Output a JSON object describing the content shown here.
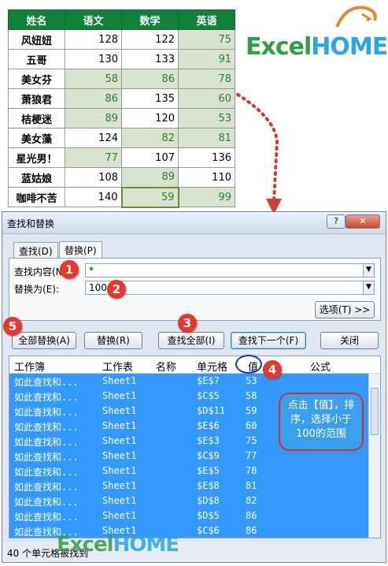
{
  "sheet": {
    "headers": [
      "姓名",
      "语文",
      "数学",
      "英语"
    ],
    "rows": [
      [
        "风妞妞",
        "128",
        "122",
        "75"
      ],
      [
        "五哥",
        "130",
        "133",
        "91"
      ],
      [
        "美女芬",
        "58",
        "86",
        "78"
      ],
      [
        "萧狼君",
        "86",
        "135",
        "60"
      ],
      [
        "桔梗迷",
        "89",
        "120",
        "53"
      ],
      [
        "美女藻",
        "124",
        "82",
        "81"
      ],
      [
        "星光男！",
        "77",
        "107",
        "136"
      ],
      [
        "蓝姑娘",
        "108",
        "89",
        "110"
      ],
      [
        "咖啡不苦",
        "140",
        "59",
        "99"
      ]
    ],
    "header_color": "#10803b",
    "highlight_color": "#d9e4d0"
  },
  "logo": {
    "part1": "Excel",
    "part2": "HOME"
  },
  "dialog": {
    "title": "查找和替换",
    "help_label": "?",
    "close_label": "✕",
    "tabs": [
      "查找(D)",
      "替换(P)"
    ],
    "active_tab": "替换(P)",
    "find_label": "查找内容(N):",
    "find_value": "*",
    "replace_label": "替换为(E):",
    "replace_value": "100",
    "options_button": "选项(T) >>",
    "buttons": {
      "replace_all": "全部替换(A)",
      "replace": "替换(R)",
      "find_all": "查找全部(I)",
      "find_next": "查找下一个(F)",
      "close": "关闭"
    },
    "columns": [
      "工作簿",
      "工作表",
      "名称",
      "单元格",
      "值",
      "公式"
    ],
    "results": [
      {
        "book": "如此查找和...",
        "sheet": "Sheet1",
        "cell": "$E$7",
        "value": "53"
      },
      {
        "book": "如此查找和...",
        "sheet": "Sheet1",
        "cell": "$C$5",
        "value": "58"
      },
      {
        "book": "如此查找和...",
        "sheet": "Sheet1",
        "cell": "$D$11",
        "value": "59"
      },
      {
        "book": "如此查找和...",
        "sheet": "Sheet1",
        "cell": "$E$6",
        "value": "60"
      },
      {
        "book": "如此查找和...",
        "sheet": "Sheet1",
        "cell": "$E$3",
        "value": "75"
      },
      {
        "book": "如此查找和...",
        "sheet": "Sheet1",
        "cell": "$C$9",
        "value": "77"
      },
      {
        "book": "如此查找和...",
        "sheet": "Sheet1",
        "cell": "$E$5",
        "value": "78"
      },
      {
        "book": "如此查找和...",
        "sheet": "Sheet1",
        "cell": "$E$8",
        "value": "81"
      },
      {
        "book": "如此查找和...",
        "sheet": "Sheet1",
        "cell": "$D$8",
        "value": "82"
      },
      {
        "book": "如此查找和...",
        "sheet": "Sheet1",
        "cell": "$D$5",
        "value": "86"
      },
      {
        "book": "如此查找和...",
        "sheet": "Sheet1",
        "cell": "$C$6",
        "value": "86"
      }
    ],
    "status": "40 个单元格被找到",
    "selection_color": "#3399ff"
  },
  "annotations": {
    "badges": [
      "1",
      "2",
      "3",
      "4",
      "5"
    ],
    "callout": "点击【值】，排序，选择小于100的范围",
    "badge_color": "#e8372d"
  }
}
